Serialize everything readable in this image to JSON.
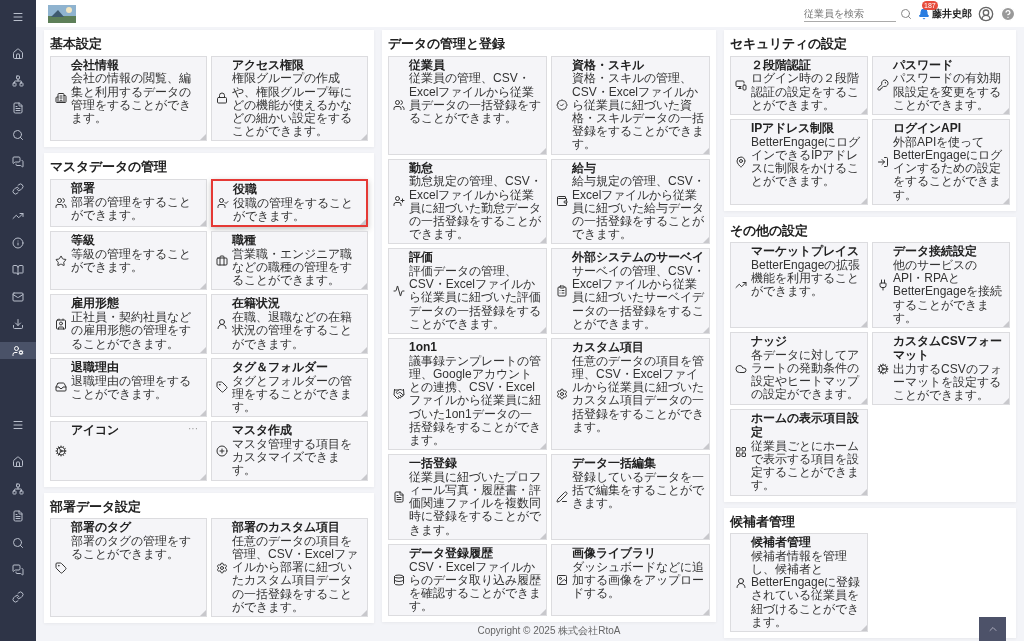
{
  "sidebar": {
    "groups": [
      {
        "items": [
          {
            "selected": false
          },
          {
            "selected": false
          },
          {
            "selected": false
          },
          {
            "selected": false
          },
          {
            "selected": false
          },
          {
            "selected": false
          },
          {
            "selected": false
          },
          {
            "selected": false
          },
          {
            "selected": false
          },
          {
            "selected": false
          },
          {
            "selected": false
          },
          {
            "selected": false
          },
          {
            "selected": true
          }
        ]
      },
      {
        "items": [
          {
            "selected": false
          },
          {
            "selected": false
          },
          {
            "selected": false
          },
          {
            "selected": false
          },
          {
            "selected": false
          },
          {
            "selected": false
          },
          {
            "selected": false
          }
        ]
      }
    ]
  },
  "topbar": {
    "search": {
      "placeholder": "従業員を検索"
    },
    "notification_count": "187",
    "user_name": "藤井史郎"
  },
  "columns": [
    {
      "sections": [
        {
          "title": "基本設定",
          "tiles": [
            {
              "title": "会社情報",
              "description": "会社の情報の閲覧、編集と利用するデータの管理をすることができます。",
              "selected": false
            },
            {
              "title": "アクセス権限",
              "description": "権限グループの作成や、権限グループ毎にどの機能が使えるかなどの細かい設定をすることができます。",
              "selected": false
            }
          ]
        },
        {
          "title": "マスタデータの管理",
          "tiles": [
            {
              "title": "部署",
              "description": "部署の管理をすることができます。",
              "selected": false
            },
            {
              "title": "役職",
              "description": "役職の管理をすることができます。",
              "selected": true
            },
            {
              "title": "等級",
              "description": "等級の管理をすることができます。",
              "selected": false
            },
            {
              "title": "職種",
              "description": "営業職・エンジニア職などの職種の管理をすることができます。",
              "selected": false
            },
            {
              "title": "雇用形態",
              "description": "正社員・契約社員などの雇用形態の管理をすることができます。",
              "selected": false
            },
            {
              "title": "在籍状況",
              "description": "在職、退職などの在籍状況の管理をすることができます。",
              "selected": false
            },
            {
              "title": "退職理由",
              "description": "退職理由の管理をすることができます。",
              "selected": false
            },
            {
              "title": "タグ＆フォルダー",
              "description": "タグとフォルダーの管理をすることができます。",
              "selected": false
            },
            {
              "title": "アイコン",
              "more": "···",
              "selected": false
            },
            {
              "title": "マスタ作成",
              "description": "マスタ管理する項目をカスタマイズできます。",
              "selected": false
            }
          ]
        },
        {
          "title": "部署データ設定",
          "tiles": [
            {
              "title": "部署のタグ",
              "description": "部署のタグの管理をすることができます。",
              "selected": false
            },
            {
              "title": "部署のカスタム項目",
              "description": "任意のデータの項目を管理、CSV・Excelファイルから部署に紐づいたカスタム項目データの一括登録をすることができます。",
              "selected": false
            }
          ]
        }
      ]
    },
    {
      "sections": [
        {
          "title": "データの管理と登録",
          "tiles": [
            {
              "title": "従業員",
              "description": "従業員の管理、CSV・Excelファイルから従業員データの一括登録をすることができます。",
              "selected": false
            },
            {
              "title": "資格・スキル",
              "description": "資格・スキルの管理、CSV・Excelファイルから従業員に紐づいた資格・スキルデータの一括登録をすることができます。",
              "selected": false
            },
            {
              "title": "勤怠",
              "description": "勤怠規定の管理、CSV・Excelファイルから従業員に紐づいた勤怠データの一括登録をすることができます。",
              "selected": false
            },
            {
              "title": "給与",
              "description": "給与規定の管理、CSV・Excelファイルから従業員に紐づいた給与データの一括登録をすることができます。",
              "selected": false
            },
            {
              "title": "評価",
              "description": "評価データの管理、CSV・Excelファイルから従業員に紐づいた評価データの一括登録をすることができます。",
              "selected": false
            },
            {
              "title": "外部システムのサーベイ",
              "description": "サーベイの管理、CSV・Excelファイルから従業員に紐づいたサーベイデータの一括登録をすることができます。",
              "selected": false
            },
            {
              "title": "1on1",
              "description": "議事録テンプレートの管理、Googleアカウントとの連携、CSV・Excelファイルから従業員に紐づいた1on1データの一括登録をすることができます。",
              "selected": false
            },
            {
              "title": "カスタム項目",
              "description": "任意のデータの項目を管理、CSV・Excelファイルから従業員に紐づいたカスタム項目データの一括登録をすることができます。",
              "selected": false
            },
            {
              "title": "一括登録",
              "description": "従業員に紐づいたプロフィール写真・履歴書・評価関連ファイルを複数同時に登録をすることができます。",
              "selected": false
            },
            {
              "title": "データ一括編集",
              "description": "登録しているデータを一括で編集をすることができます。",
              "selected": false
            },
            {
              "title": "データ登録履歴",
              "description": "CSV・Excelファイルからのデータ取り込み履歴を確認することができます。",
              "selected": false
            },
            {
              "title": "画像ライブラリ",
              "description": "ダッシュボードなどに追加する画像をアップロードする。",
              "selected": false
            }
          ]
        }
      ]
    },
    {
      "sections": [
        {
          "title": "セキュリティの設定",
          "tiles": [
            {
              "title": "２段階認証",
              "description": "ログイン時の２段階認証の設定をすることができます。",
              "selected": false
            },
            {
              "title": "パスワード",
              "description": "パスワードの有効期限設定を変更をすることができます。",
              "selected": false
            },
            {
              "title": "IPアドレス制限",
              "description": "BetterEngageにログインできるIPアドレスに制限をかけることができます。",
              "selected": false
            },
            {
              "title": "ログインAPI",
              "description": "外部APIを使ってBetterEngageにログインするための設定をすることができます。",
              "selected": false
            }
          ]
        },
        {
          "title": "その他の設定",
          "tiles": [
            {
              "title": "マーケットプレイス",
              "description": "BetterEngageの拡張機能を利用することができます。",
              "selected": false
            },
            {
              "title": "データ接続設定",
              "description": "他のサービスのAPI・RPAとBetterEngageを接続することができます。",
              "selected": false
            },
            {
              "title": "ナッジ",
              "description": "各データに対してアラートの発動条件の設定やヒートマップの設定ができます。",
              "selected": false
            },
            {
              "title": "カスタムCSVフォーマット",
              "description": "出力するCSVのフォーマットを設定することができます。",
              "selected": false
            },
            {
              "title": "ホームの表示項目設定",
              "description": "従業員ごとにホームで表示する項目を設定することができます。",
              "selected": false
            }
          ]
        },
        {
          "title": "候補者管理",
          "tiles": [
            {
              "title": "候補者管理",
              "description": "候補者情報を管理し、候補者とBetterEngageに登録されている従業員を紐づけることができます。",
              "selected": false
            }
          ]
        }
      ]
    }
  ],
  "footer": {
    "copyright": "Copyright © 2025 株式会社RtoA"
  }
}
